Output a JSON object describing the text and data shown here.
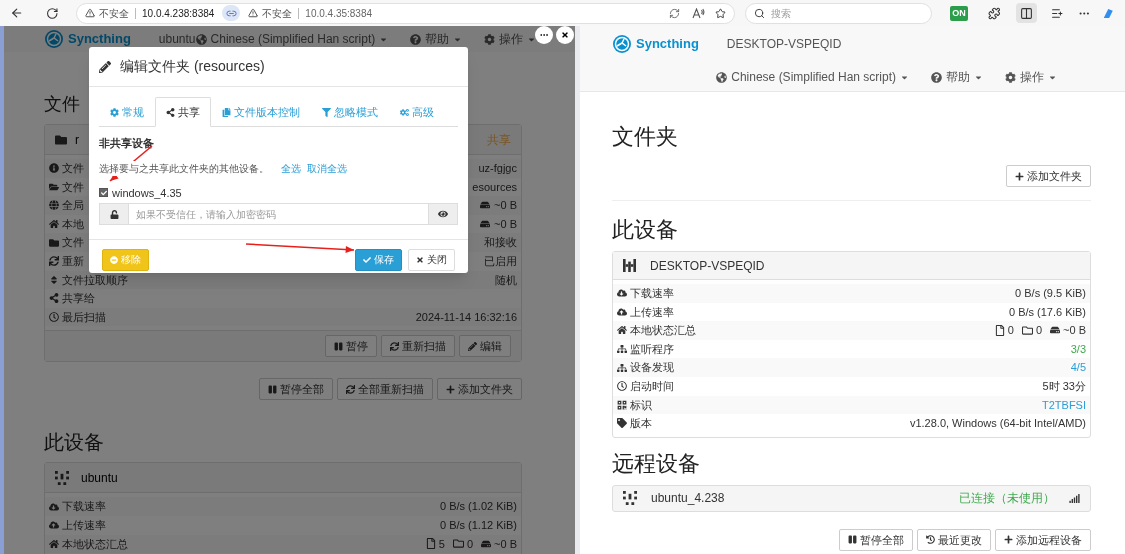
{
  "browser": {
    "addresses": [
      {
        "warning": "不安全",
        "url": "10.0.4.238:8384"
      },
      {
        "warning": "不安全",
        "url": "10.0.4.35:8384"
      }
    ],
    "search_placeholder": "搜索",
    "extension_badge": "ON"
  },
  "left_pane": {
    "navbar": {
      "brand": "Syncthing",
      "device": "ubuntu",
      "menus": [
        "Chinese (Simplified Han script)",
        "帮助",
        "操作"
      ]
    },
    "folders_heading": "文件",
    "folder": {
      "name": "r",
      "status": "共享",
      "rows": [
        {
          "label": "文件",
          "kind": "text",
          "value": "uz-fgjgc"
        },
        {
          "label": "文件",
          "kind": "text",
          "value": "esources"
        },
        {
          "label": "全局",
          "kind": "size",
          "value": "~0 B"
        },
        {
          "label": "本地",
          "kind": "size",
          "value": "~0 B"
        },
        {
          "label": "文件",
          "kind": "text",
          "value": "和接收"
        },
        {
          "label": "重新",
          "kind": "text",
          "value": "已启用"
        },
        {
          "label": "文件拉取顺序",
          "kind": "text",
          "value": "随机"
        },
        {
          "label": "共享给",
          "kind": "text"
        },
        {
          "label": "最后扫描",
          "kind": "text",
          "value": "2024-11-14 16:32:16"
        }
      ],
      "buttons": [
        "暂停",
        "重新扫描",
        "编辑"
      ]
    },
    "folder_actions": [
      "暂停全部",
      "全部重新扫描",
      "添加文件夹"
    ],
    "device_heading": "此设备",
    "device": {
      "name": "ubuntu",
      "rows": [
        {
          "label": "下载速率",
          "kind": "text",
          "value": "0 B/s (1.02 KiB)"
        },
        {
          "label": "上传速率",
          "kind": "text",
          "value": "0 B/s (1.12 KiB)"
        },
        {
          "label": "本地状态汇总",
          "kind": "summary",
          "files": "5",
          "folders": "0",
          "size": "~0 B"
        }
      ]
    }
  },
  "modal": {
    "title": "编辑文件夹 (resources)",
    "tabs": [
      {
        "label": "常规",
        "selected": false
      },
      {
        "label": "共享",
        "selected": true
      },
      {
        "label": "文件版本控制",
        "selected": false
      },
      {
        "label": "忽略模式",
        "selected": false
      },
      {
        "label": "高级",
        "selected": false
      }
    ],
    "section_title": "非共享设备",
    "hint": "选择要与之共享此文件夹的其他设备。",
    "links": [
      "全选",
      "取消全选"
    ],
    "device": {
      "name": "windows_4.35",
      "checked": true,
      "password_placeholder": "如果不受信任，请输入加密密码"
    },
    "buttons": [
      {
        "label": "移除",
        "kind": "warning"
      },
      {
        "label": "保存",
        "kind": "primary"
      },
      {
        "label": "关闭",
        "kind": "default"
      }
    ]
  },
  "right_pane": {
    "navbar": {
      "brand": "Syncthing",
      "device": "DESKTOP-VSPEQID",
      "menus": [
        "Chinese (Simplified Han script)",
        "帮助",
        "操作"
      ]
    },
    "folders_heading": "文件夹",
    "add_folder": "添加文件夹",
    "device_heading": "此设备",
    "device": {
      "name": "DESKTOP-VSPEQID",
      "rows": [
        {
          "label": "下载速率",
          "kind": "text",
          "value": "0 B/s (9.5 KiB)"
        },
        {
          "label": "上传速率",
          "kind": "text",
          "value": "0 B/s (17.6 KiB)"
        },
        {
          "label": "本地状态汇总",
          "kind": "summary",
          "files": "0",
          "folders": "0",
          "size": "~0 B"
        },
        {
          "label": "监听程序",
          "kind": "success",
          "value": "3/3"
        },
        {
          "label": "设备发现",
          "kind": "link",
          "value": "4/5"
        },
        {
          "label": "启动时间",
          "kind": "text",
          "value": "5时 33分"
        },
        {
          "label": "标识",
          "kind": "link",
          "value": "T2TBFSI"
        },
        {
          "label": "版本",
          "kind": "text",
          "value": "v1.28.0, Windows (64-bit Intel/AMD)"
        }
      ]
    },
    "remote_heading": "远程设备",
    "remotes": [
      {
        "name": "ubuntu_4.238",
        "status": "已连接（未使用）"
      }
    ],
    "buttons": [
      "暂停全部",
      "最近更改",
      "添加远程设备"
    ]
  }
}
